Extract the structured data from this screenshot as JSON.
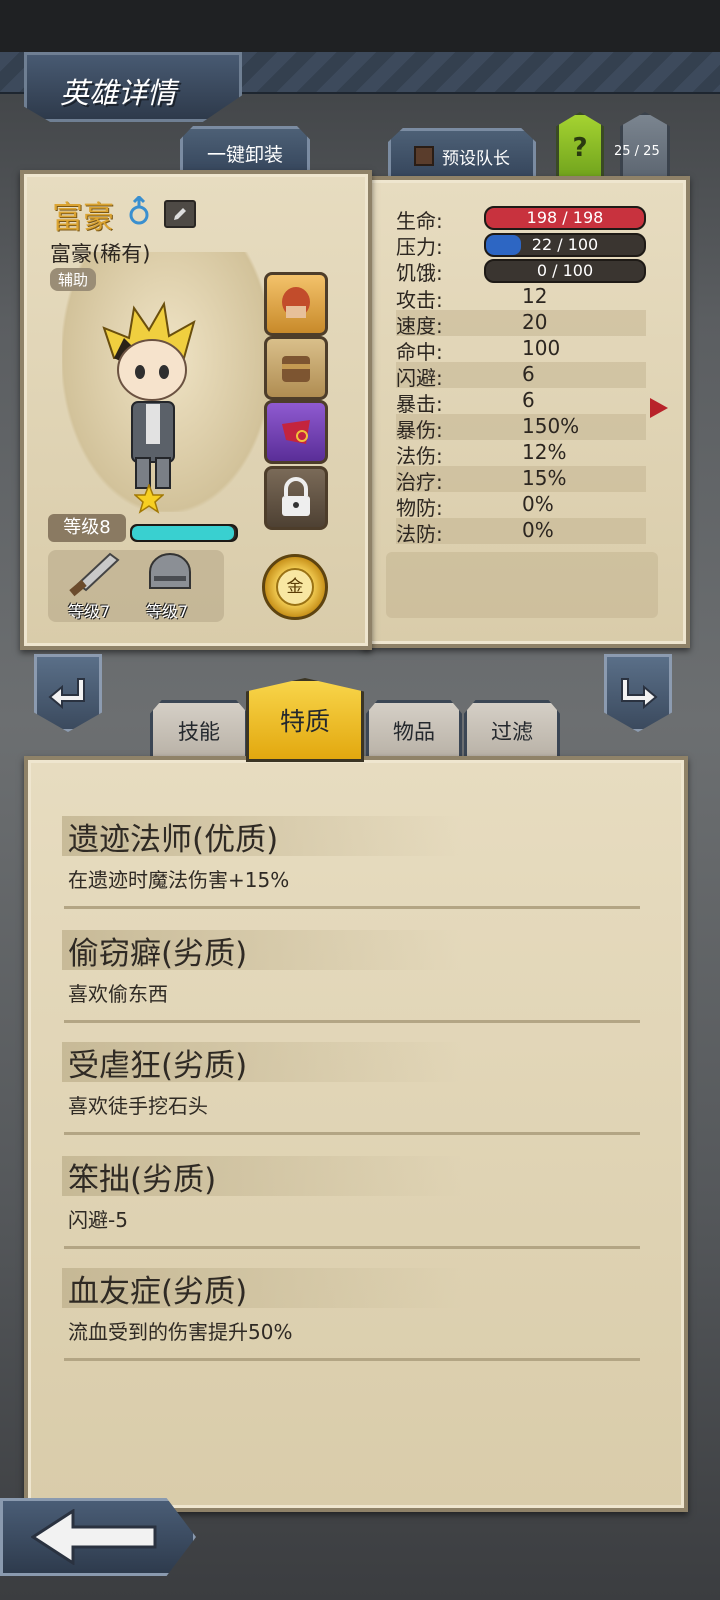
{
  "header": {
    "title": "英雄详情"
  },
  "toolbar": {
    "unequip_all": "一键卸装",
    "preset_leader": "预设队长",
    "help": "?",
    "roster_count": "25 / 25"
  },
  "hero": {
    "name": "富豪",
    "subtitle": "富豪(稀有)",
    "role": "辅助",
    "level_label": "等级8",
    "xp_fraction": 0.98,
    "weapon_level": "等级7",
    "armor_level": "等级7",
    "gold_badge": "金"
  },
  "stats": {
    "hp": {
      "label": "生命:",
      "value": "198 / 198",
      "fraction": 1.0
    },
    "stress": {
      "label": "压力:",
      "value": "22 / 100",
      "fraction": 0.22
    },
    "hunger": {
      "label": "饥饿:",
      "value": "0 / 100",
      "fraction": 0.0
    },
    "rows": [
      {
        "label": "攻击:",
        "value": "12"
      },
      {
        "label": "速度:",
        "value": "20"
      },
      {
        "label": "命中:",
        "value": "100"
      },
      {
        "label": "闪避:",
        "value": "6"
      },
      {
        "label": "暴击:",
        "value": "6"
      },
      {
        "label": "暴伤:",
        "value": "150%"
      },
      {
        "label": "法伤:",
        "value": "12%"
      },
      {
        "label": "治疗:",
        "value": "15%"
      },
      {
        "label": "物防:",
        "value": "0%"
      },
      {
        "label": "法防:",
        "value": "0%"
      }
    ]
  },
  "tabs": {
    "skills": "技能",
    "traits": "特质",
    "items": "物品",
    "filter": "过滤",
    "active": "traits"
  },
  "traits": [
    {
      "title": "遗迹法师(优质)",
      "desc": "在遗迹时魔法伤害+15%"
    },
    {
      "title": "偷窃癖(劣质)",
      "desc": "喜欢偷东西"
    },
    {
      "title": "受虐狂(劣质)",
      "desc": "喜欢徒手挖石头"
    },
    {
      "title": "笨拙(劣质)",
      "desc": "闪避-5"
    },
    {
      "title": "血友症(劣质)",
      "desc": "流血受到的伤害提升50%"
    }
  ],
  "colors": {
    "hp": "#c8323e",
    "stress": "#2d66c3",
    "xp": "#39d0d0",
    "active_tab": "#f2c21b",
    "help": "#8fbf2a"
  },
  "icons": [
    "male-icon",
    "edit-icon",
    "helmet-icon",
    "chest-icon",
    "cape-icon",
    "lock-icon",
    "sword-icon",
    "helmet-armor-icon",
    "gold-coin-icon",
    "arrow-left-icon",
    "arrow-right-icon",
    "back-arrow-icon",
    "expand-arrow-icon"
  ]
}
